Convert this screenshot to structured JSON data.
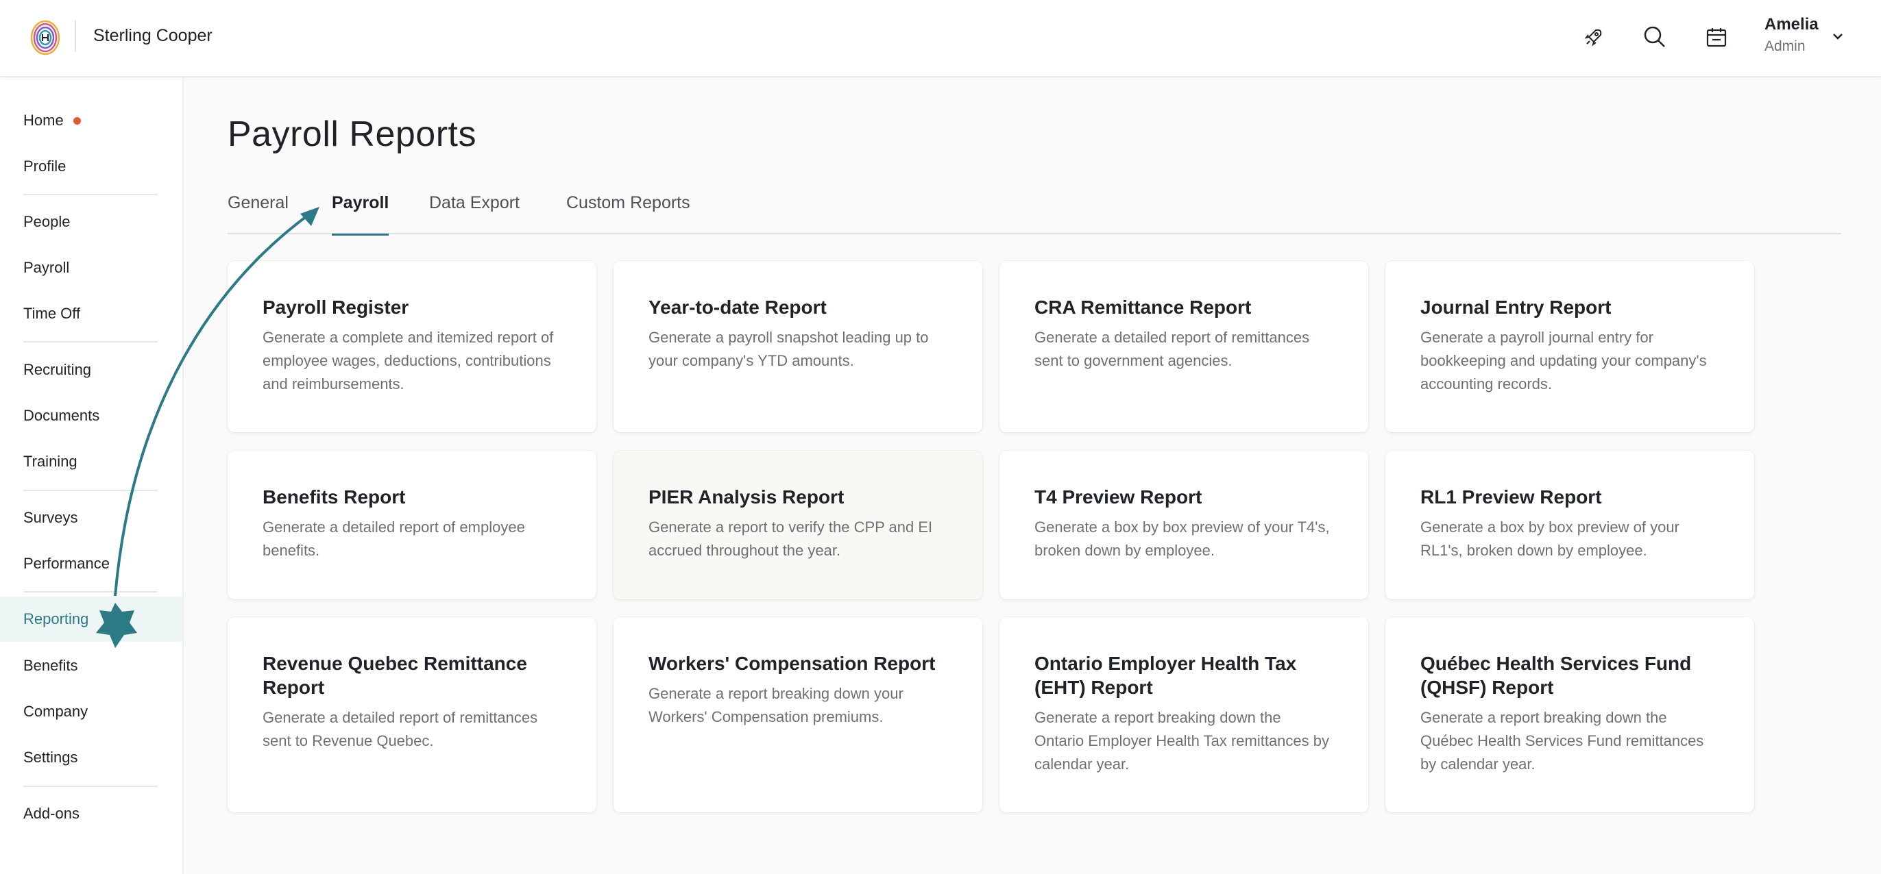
{
  "header": {
    "company_name": "Sterling Cooper",
    "user_name": "Amelia",
    "user_role": "Admin",
    "icons": [
      "rocket-icon",
      "search-icon",
      "calendar-icon",
      "chevron-down-icon"
    ]
  },
  "sidebar": {
    "items": [
      {
        "label": "Home",
        "has_dot": true
      },
      {
        "label": "Profile"
      },
      {
        "label": "People"
      },
      {
        "label": "Payroll"
      },
      {
        "label": "Time Off"
      },
      {
        "label": "Recruiting"
      },
      {
        "label": "Documents"
      },
      {
        "label": "Training"
      },
      {
        "label": "Surveys"
      },
      {
        "label": "Performance"
      },
      {
        "label": "Reporting",
        "active": true
      },
      {
        "label": "Benefits"
      },
      {
        "label": "Company"
      },
      {
        "label": "Settings"
      },
      {
        "label": "Add-ons"
      }
    ]
  },
  "main": {
    "title": "Payroll Reports",
    "tabs": [
      {
        "label": "General"
      },
      {
        "label": "Payroll",
        "active": true
      },
      {
        "label": "Data Export"
      },
      {
        "label": "Custom Reports"
      }
    ],
    "cards": [
      {
        "title": "Payroll Register",
        "desc": "Generate a complete and itemized report of employee wages, deductions, contributions and reimbursements."
      },
      {
        "title": "Year-to-date Report",
        "desc": "Generate a payroll snapshot leading up to your company's YTD amounts."
      },
      {
        "title": "CRA Remittance Report",
        "desc": "Generate a detailed report of remittances sent to government agencies."
      },
      {
        "title": "Journal Entry Report",
        "desc": "Generate a payroll journal entry for bookkeeping and updating your company's accounting records."
      },
      {
        "title": "Benefits Report",
        "desc": "Generate a detailed report of employee benefits."
      },
      {
        "title": "PIER Analysis Report",
        "desc": "Generate a report to verify the CPP and EI accrued throughout the year."
      },
      {
        "title": "T4 Preview Report",
        "desc": "Generate a box by box preview of your T4's, broken down by employee."
      },
      {
        "title": "RL1 Preview Report",
        "desc": "Generate a box by box preview of your RL1's, broken down by employee."
      },
      {
        "title": "Revenue Quebec Remittance Report",
        "desc": "Generate a detailed report of remittances sent to Revenue Quebec."
      },
      {
        "title": "Workers' Compensation Report",
        "desc": "Generate a report breaking down your Workers' Compensation premiums."
      },
      {
        "title": "Ontario Employer Health Tax (EHT) Report",
        "desc": "Generate a report breaking down the Ontario Employer Health Tax remittances by calendar year."
      },
      {
        "title": "Québec Health Services Fund (QHSF) Report",
        "desc": "Generate a report breaking down the Québec Health Services Fund remittances by calendar year."
      }
    ]
  },
  "colors": {
    "accent": "#2c7a85",
    "notification_dot": "#e0583a",
    "active_nav_bg": "#eef5f5"
  }
}
